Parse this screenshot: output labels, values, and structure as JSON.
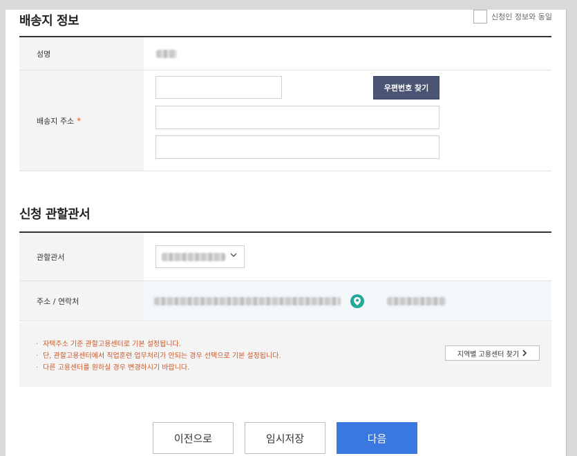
{
  "shipping": {
    "title": "배송지 정보",
    "agree_label": "신청인 정보와 동일",
    "name_label": "성명",
    "address_label": "배송지 주소",
    "required_mark": "*",
    "zip_button": "우편번호 찾기",
    "zip_value": "",
    "address1_value": "",
    "address2_value": ""
  },
  "office": {
    "title": "신청 관할관서",
    "office_label": "관할관서",
    "contact_label": "주소 / 연락처"
  },
  "notice": {
    "items": [
      "자택주소 기준 관할고용센터로 기본 설정됩니다.",
      "단, 관할고용센터에서 직업훈련 업무처리가 안되는 경우 선택으로 기본 설정됩니다.",
      "다른 고용센터를 원하실 경우 변경하시기 바랍니다."
    ],
    "region_button": "지역별 고용센터 찾기"
  },
  "footer": {
    "prev": "이전으로",
    "temp_save": "임시저장",
    "next": "다음"
  },
  "colors": {
    "accent_blue": "#3a78e0",
    "zip_button": "#4a5474",
    "notice_text": "#c9582a",
    "pin": "#23a99a",
    "required": "#e8552a"
  }
}
